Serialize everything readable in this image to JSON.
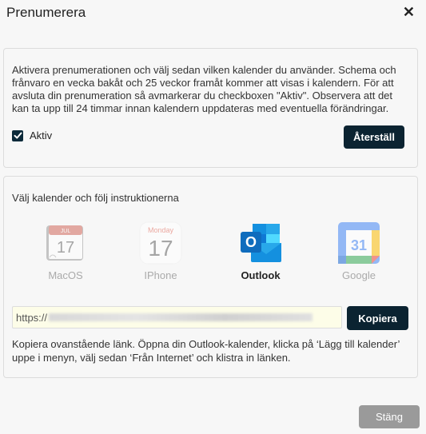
{
  "dialog": {
    "title": "Prenumerera",
    "close_glyph": "✕"
  },
  "subscription": {
    "description": "Aktivera prenumerationen och välj sedan vilken kalender du använder. Schema och frånvaro en vecka bakåt och 25 veckor framåt kommer att visas i kalendern. För att avsluta din prenumeration så avmarkerar du checkboxen \"Aktiv\". Observera att det kan ta upp till 24 timmar innan kalendern uppdateras med eventuella förändringar.",
    "active_label": "Aktiv",
    "active_checked": true,
    "reset_label": "Återställ"
  },
  "calendars": {
    "heading": "Välj kalender och följ instruktionerna",
    "options": [
      {
        "label": "MacOS",
        "icon": "macos-calendar-icon",
        "icon_month": "JUL",
        "icon_day": "17",
        "selected": false
      },
      {
        "label": "IPhone",
        "icon": "iphone-calendar-icon",
        "icon_month": "Monday",
        "icon_day": "17",
        "selected": false
      },
      {
        "label": "Outlook",
        "icon": "outlook-icon",
        "icon_letter": "O",
        "selected": true
      },
      {
        "label": "Google",
        "icon": "google-calendar-icon",
        "icon_day": "31",
        "selected": false
      }
    ],
    "url_prefix": "https://",
    "copy_label": "Kopiera",
    "instructions": "Kopiera ovanstående länk. Öppna din Outlook-kalender, klicka på ‘Lägg till kalender’ uppe i menyn, välj sedan ‘Från Internet’ och klistra in länken."
  },
  "footer": {
    "close_label": "Stäng"
  },
  "colors": {
    "primary_button": "#0b2331",
    "disabled_button": "#9a9a9a",
    "outlook_blue": "#0f6cbd",
    "url_background": "#fdfde8"
  }
}
